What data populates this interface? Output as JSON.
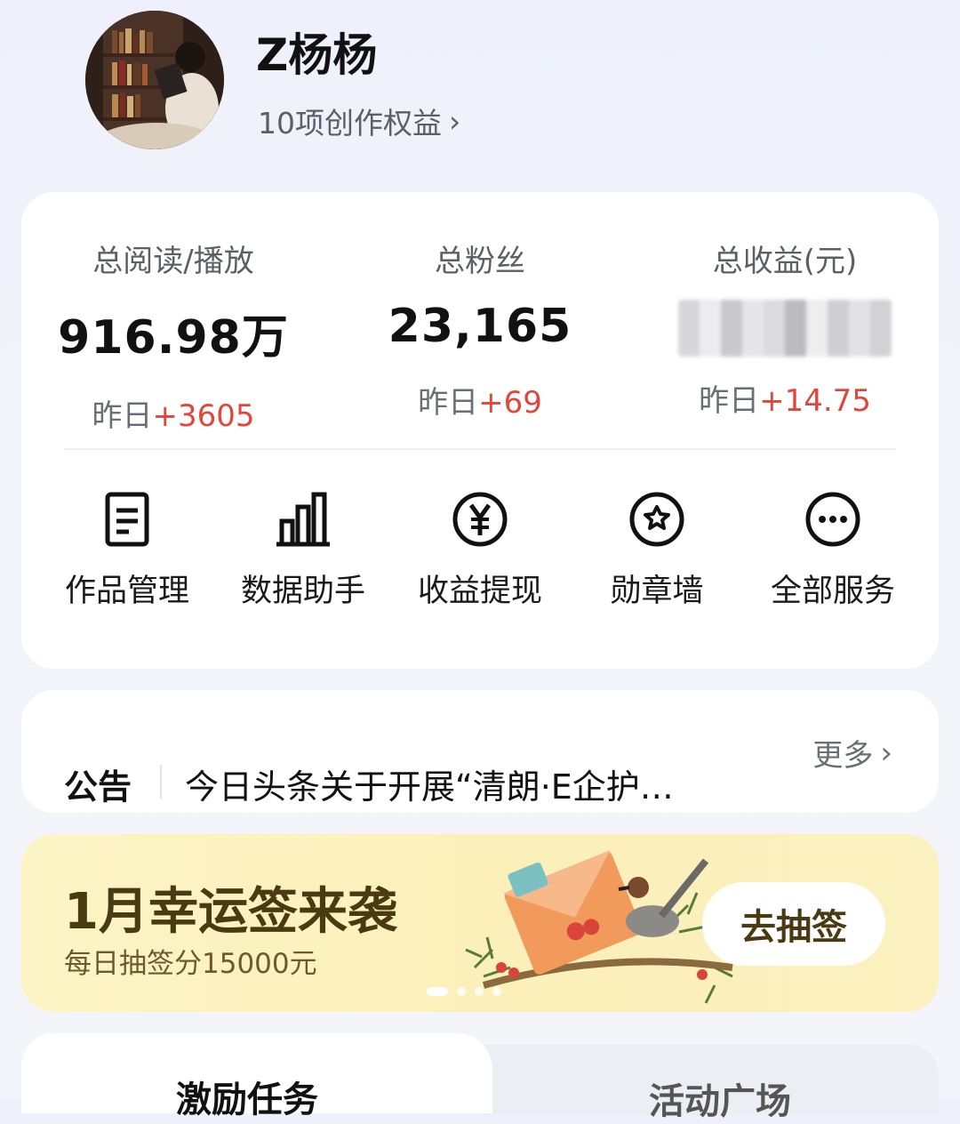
{
  "profile": {
    "username": "Z杨杨",
    "rights_label": "10项创作权益",
    "rights_chevron": "›"
  },
  "stats": [
    {
      "label": "总阅读/播放",
      "value": "916.98万",
      "delta_prefix": "昨日",
      "delta_value": "+3605"
    },
    {
      "label": "总粉丝",
      "value": "23,165",
      "delta_prefix": "昨日",
      "delta_value": "+69"
    },
    {
      "label": "总收益(元)",
      "value": "",
      "delta_prefix": "昨日",
      "delta_value": "+14.75"
    }
  ],
  "services": [
    {
      "label": "作品管理",
      "icon": "document-icon"
    },
    {
      "label": "数据助手",
      "icon": "bar-chart-icon"
    },
    {
      "label": "收益提现",
      "icon": "yuan-icon"
    },
    {
      "label": "勋章墙",
      "icon": "medal-icon"
    },
    {
      "label": "全部服务",
      "icon": "more-dots-icon"
    }
  ],
  "notice": {
    "tag": "公告",
    "text": "今日头条关于开展“清朗·E企护…",
    "more": "更多",
    "more_chevron": "›"
  },
  "banner": {
    "title": "1月幸运签来袭",
    "subtitle": "每日抽签分15000元",
    "button": "去抽签",
    "page_count": 5,
    "active_page": 1
  },
  "tabs": [
    {
      "label": "激励任务",
      "active": true
    },
    {
      "label": "活动广场",
      "active": false
    }
  ],
  "colors": {
    "positive": "#e2463b",
    "banner_bg": "#fbf0b9",
    "banner_text": "#4a3a12"
  }
}
